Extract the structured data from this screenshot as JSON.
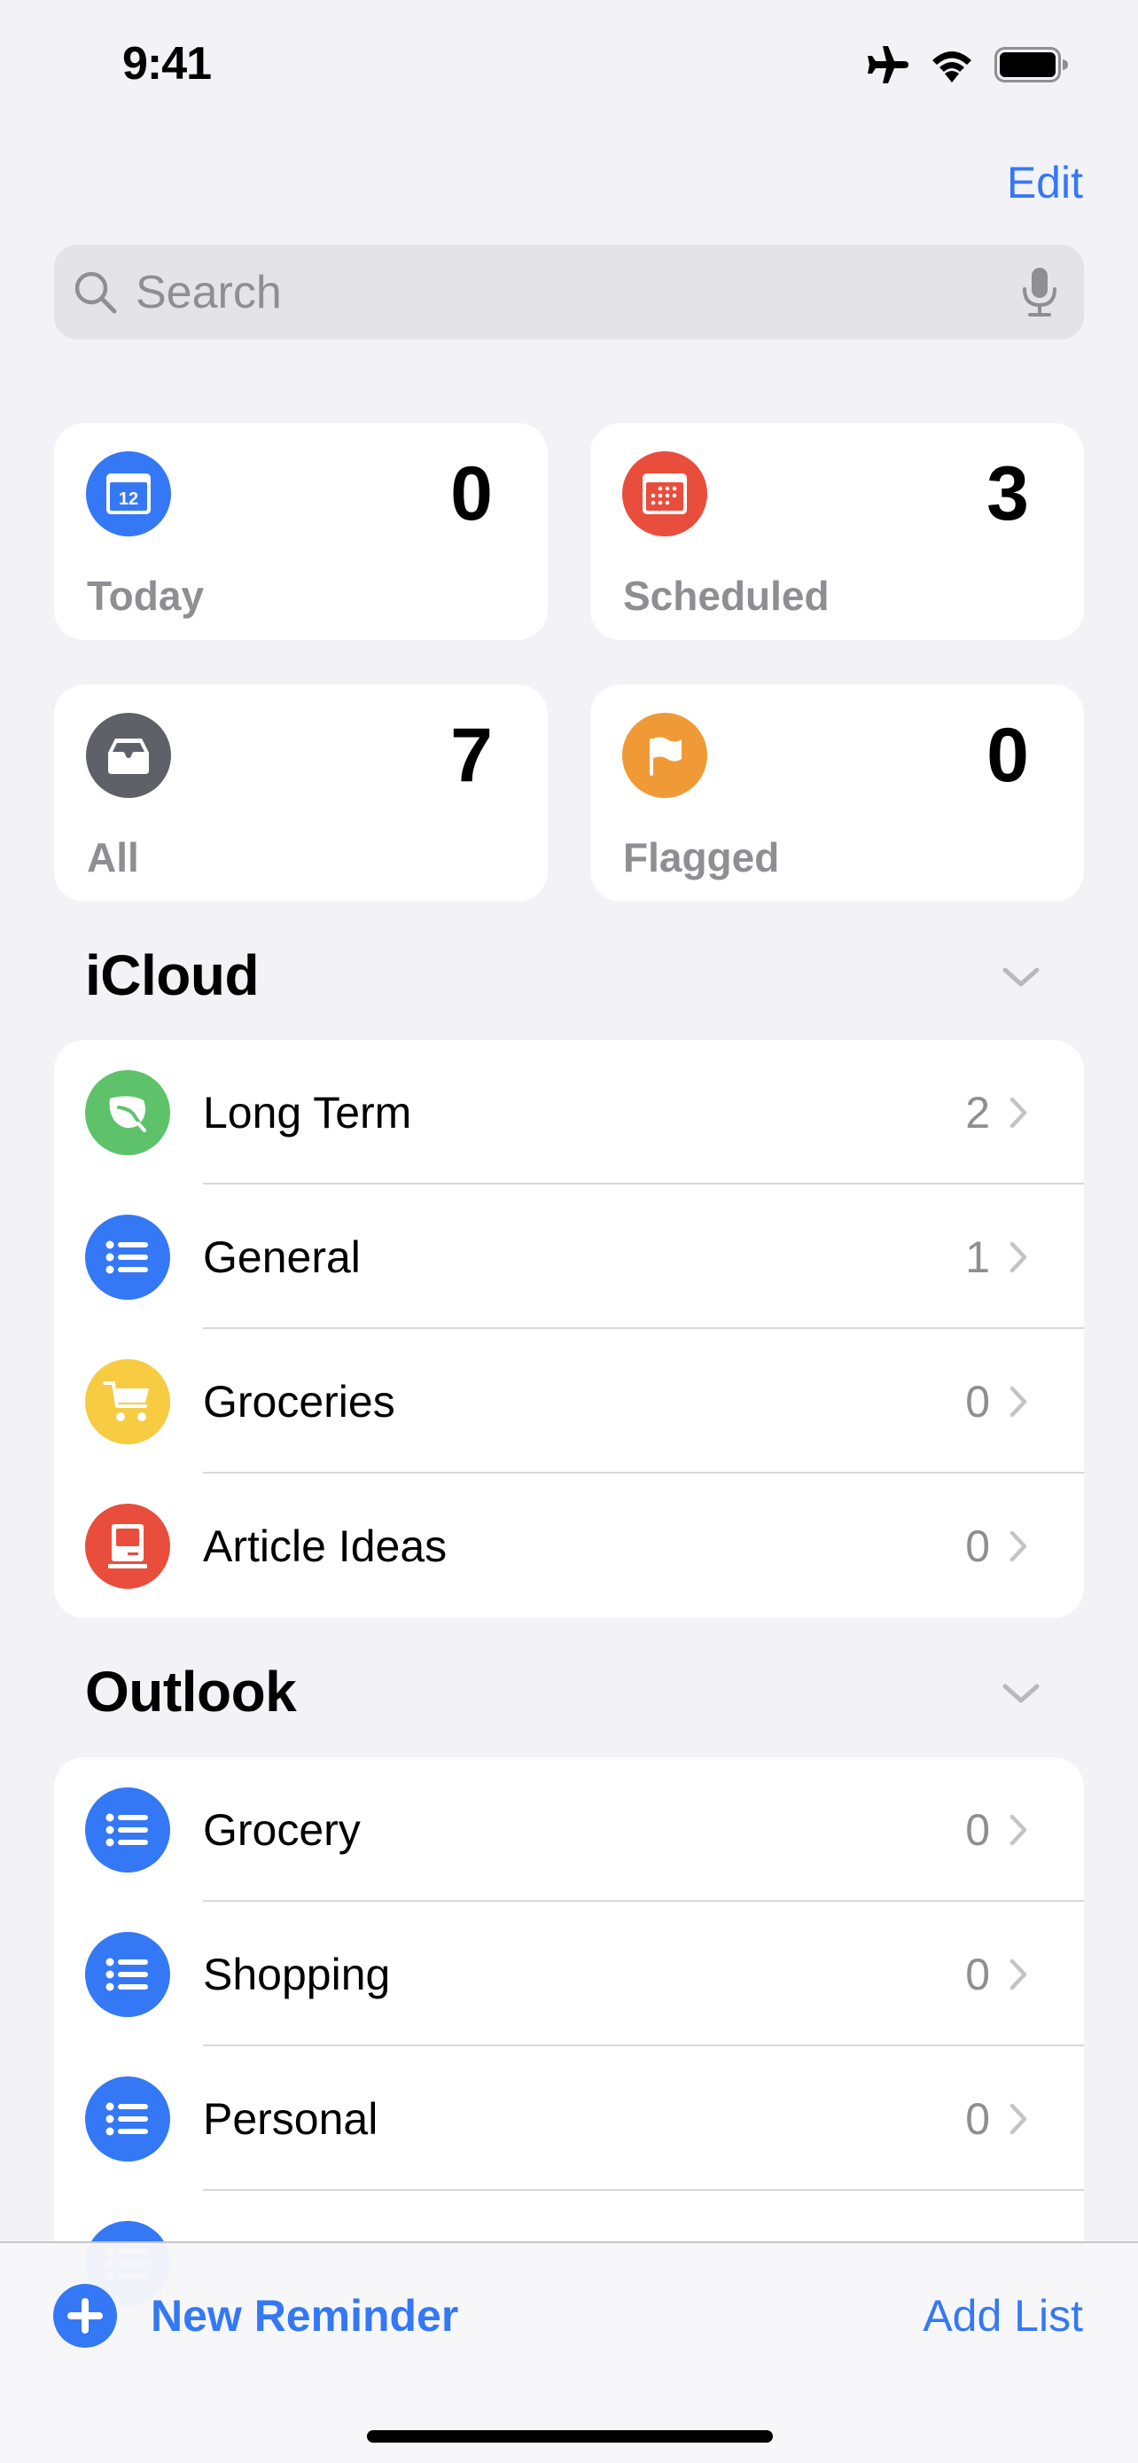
{
  "status_bar": {
    "time": "9:41",
    "icons": [
      "airplane-mode-icon",
      "wifi-icon",
      "battery-icon"
    ]
  },
  "nav": {
    "edit_label": "Edit"
  },
  "search": {
    "placeholder": "Search",
    "value": "",
    "icons": [
      "search-icon",
      "microphone-icon"
    ]
  },
  "smart_lists": [
    {
      "label": "Today",
      "count": "0",
      "icon": "calendar-today-icon",
      "color": "#3478f6",
      "day": "12"
    },
    {
      "label": "Scheduled",
      "count": "3",
      "icon": "calendar-scheduled-icon",
      "color": "#e94e3d"
    },
    {
      "label": "All",
      "count": "7",
      "icon": "tray-icon",
      "color": "#5e6168"
    },
    {
      "label": "Flagged",
      "count": "0",
      "icon": "flag-icon",
      "color": "#f09a37"
    }
  ],
  "sections": [
    {
      "title": "iCloud",
      "lists": [
        {
          "label": "Long Term",
          "count": "2",
          "icon": "leaf-icon",
          "color": "#5ec26a"
        },
        {
          "label": "General",
          "count": "1",
          "icon": "list-bullet-icon",
          "color": "#3478f6"
        },
        {
          "label": "Groceries",
          "count": "0",
          "icon": "cart-icon",
          "color": "#f7cb42"
        },
        {
          "label": "Article Ideas",
          "count": "0",
          "icon": "computer-icon",
          "color": "#e94e3d"
        }
      ]
    },
    {
      "title": "Outlook",
      "lists": [
        {
          "label": "Grocery",
          "count": "0",
          "icon": "list-bullet-icon",
          "color": "#3478f6"
        },
        {
          "label": "Shopping",
          "count": "0",
          "icon": "list-bullet-icon",
          "color": "#3478f6"
        },
        {
          "label": "Personal",
          "count": "0",
          "icon": "list-bullet-icon",
          "color": "#3478f6"
        },
        {
          "label": "",
          "count": "",
          "icon": "list-bullet-icon",
          "color": "#3478f6"
        }
      ]
    }
  ],
  "toolbar": {
    "new_reminder_label": "New Reminder",
    "add_list_label": "Add List"
  },
  "colors": {
    "accent": "#3478f6",
    "background": "#f2f2f7",
    "secondary_text": "#8e8e93"
  }
}
